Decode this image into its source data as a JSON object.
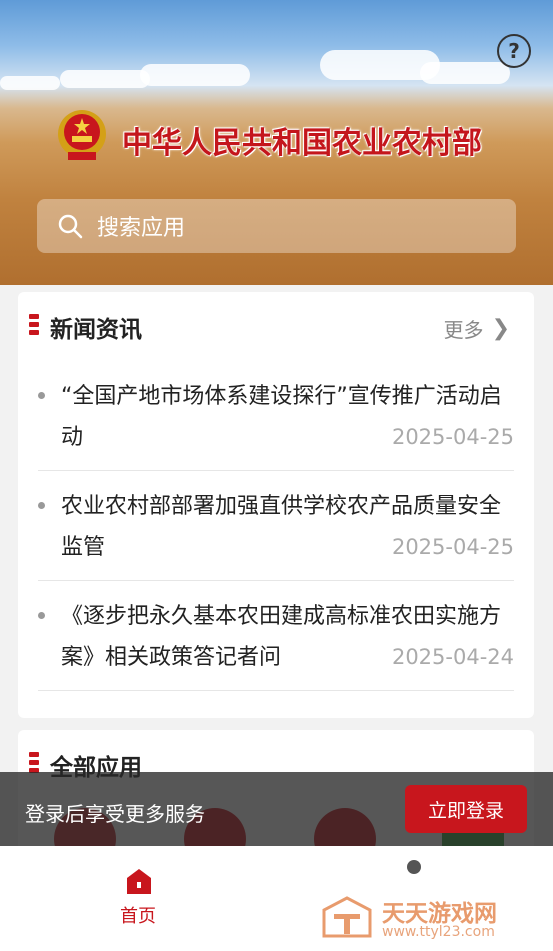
{
  "header": {
    "ministry_name": "中华人民共和国农业农村部",
    "search_placeholder": "搜索应用"
  },
  "news": {
    "title": "新闻资讯",
    "more_label": "更多",
    "items": [
      {
        "title": "“全国产地市场体系建设探行”宣传推广活动启动",
        "date": "2025-04-25"
      },
      {
        "title": "农业农村部部署加强直供学校农产品质量安全监管",
        "date": "2025-04-25"
      },
      {
        "title": "《逐步把永久基本农田建成高标准农田实施方案》相关政策答记者问",
        "date": "2025-04-24"
      }
    ]
  },
  "apps": {
    "title": "全部应用"
  },
  "login_banner": {
    "prompt": "登录后享受更多服务",
    "button": "立即登录"
  },
  "tabbar": {
    "home_label": "首页"
  },
  "watermark": {
    "title": "天天游戏网",
    "url": "www.ttyl23.com"
  },
  "colors": {
    "accent": "#c8161d",
    "text": "#222222",
    "muted": "#aaaaaa"
  }
}
